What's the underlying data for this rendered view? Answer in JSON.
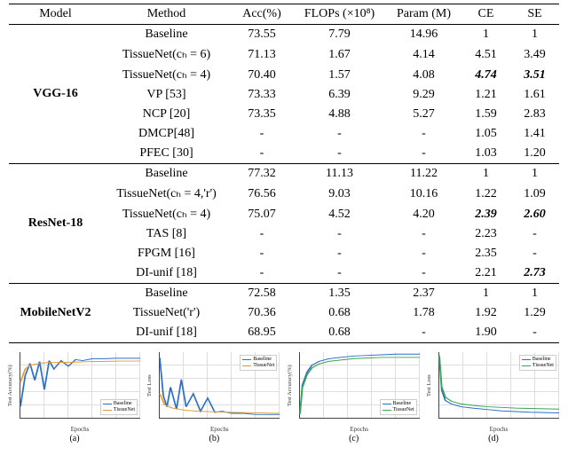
{
  "headers": {
    "model": "Model",
    "method": "Method",
    "acc": "Acc(%)",
    "flops": "FLOPs (×10⁸)",
    "param": "Param (M)",
    "ce": "CE",
    "se": "SE"
  },
  "groups": [
    {
      "model_label": "VGG-16",
      "rows": [
        {
          "method": "Baseline",
          "acc": "73.55",
          "flops": "7.79",
          "param": "14.96",
          "ce": "1",
          "se": "1"
        },
        {
          "method": "TissueNet(cₕ = 6)",
          "acc": "71.13",
          "flops": "1.67",
          "param": "4.14",
          "ce": "4.51",
          "se": "3.49"
        },
        {
          "method": "TissueNet(cₕ = 4)",
          "acc": "70.40",
          "flops": "1.57",
          "param": "4.08",
          "ce": "4.74",
          "se": "3.51",
          "ce_bi": true,
          "se_bi": true
        },
        {
          "method": "VP [53]",
          "acc": "73.33",
          "flops": "6.39",
          "param": "9.29",
          "ce": "1.21",
          "se": "1.61"
        },
        {
          "method": "NCP [20]",
          "acc": "73.35",
          "flops": "4.88",
          "param": "5.27",
          "ce": "1.59",
          "se": "2.83"
        },
        {
          "method": "DMCP[48]",
          "acc": "-",
          "flops": "-",
          "param": "-",
          "ce": "1.05",
          "se": "1.41"
        },
        {
          "method": "PFEC [30]",
          "acc": "-",
          "flops": "-",
          "param": "-",
          "ce": "1.03",
          "se": "1.20"
        }
      ]
    },
    {
      "model_label": "ResNet-18",
      "rows": [
        {
          "method": "Baseline",
          "acc": "77.32",
          "flops": "11.13",
          "param": "11.22",
          "ce": "1",
          "se": "1"
        },
        {
          "method": "TissueNet(cₕ = 4,'r')",
          "acc": "76.56",
          "flops": "9.03",
          "param": "10.16",
          "ce": "1.22",
          "se": "1.09"
        },
        {
          "method": "TissueNet(cₕ = 4)",
          "acc": "75.07",
          "flops": "4.52",
          "param": "4.20",
          "ce": "2.39",
          "se": "2.60",
          "ce_bi": true,
          "se_bi": true
        },
        {
          "method": "TAS [8]",
          "acc": "-",
          "flops": "-",
          "param": "-",
          "ce": "2.23",
          "se": "-"
        },
        {
          "method": "FPGM [16]",
          "acc": "-",
          "flops": "-",
          "param": "-",
          "ce": "2.35",
          "se": "-"
        },
        {
          "method": "DI-unif [18]",
          "acc": "-",
          "flops": "-",
          "param": "-",
          "ce": "2.21",
          "se": "2.73",
          "se_bi": true
        }
      ]
    },
    {
      "model_label": "MobileNetV2",
      "rows": [
        {
          "method": "Baseline",
          "acc": "72.58",
          "flops": "1.35",
          "param": "2.37",
          "ce": "1",
          "se": "1"
        },
        {
          "method": "TissueNet('r')",
          "acc": "70.36",
          "flops": "0.68",
          "param": "1.78",
          "ce": "1.92",
          "se": "1.29"
        },
        {
          "method": "DI-unif [18]",
          "acc": "68.95",
          "flops": "0.68",
          "param": "-",
          "ce": "1.90",
          "se": "-"
        }
      ]
    }
  ],
  "charts": {
    "xlabel": "Epochs",
    "legend": {
      "baseline": "Baseline",
      "tissuenet": "TissueNet"
    },
    "colors": {
      "baseline": "#2b6fca",
      "tissuenet": "#e69a2d",
      "tissuenet_alt": "#3aa553"
    },
    "items": [
      {
        "caption": "(a)",
        "ylabel": "Test Accuracy(%)",
        "ylim": [
          10,
          80
        ],
        "xlim": [
          0,
          500
        ],
        "legend_pos": "br"
      },
      {
        "caption": "(b)",
        "ylabel": "Test Loss",
        "ylim": [
          1,
          7
        ],
        "xlim": [
          0,
          500
        ],
        "legend_pos": "tr"
      },
      {
        "caption": "(c)",
        "ylabel": "Test Accuracy(%)",
        "ylim": [
          45,
          95
        ],
        "xlim": [
          0,
          500
        ],
        "legend_pos": "br",
        "tissuenet_color": "tissuenet_alt"
      },
      {
        "caption": "(d)",
        "ylabel": "Test Loss",
        "ylim": [
          0.1,
          2
        ],
        "xlim": [
          0,
          500
        ],
        "legend_pos": "tr",
        "tissuenet_color": "tissuenet_alt"
      }
    ]
  },
  "chart_data": [
    {
      "type": "line",
      "title": "",
      "xlabel": "Epochs",
      "ylabel": "Test Accuracy(%)",
      "xlim": [
        0,
        500
      ],
      "ylim": [
        10,
        80
      ],
      "series": [
        {
          "name": "Baseline",
          "x": [
            0,
            20,
            40,
            60,
            80,
            100,
            120,
            140,
            170,
            200,
            230,
            260,
            300,
            350,
            400,
            450,
            500
          ],
          "y": [
            22,
            55,
            68,
            50,
            70,
            40,
            71,
            62,
            71,
            65,
            72,
            71,
            73,
            73,
            73.5,
            73.5,
            73.5
          ]
        },
        {
          "name": "TissueNet",
          "x": [
            0,
            20,
            40,
            80,
            120,
            180,
            240,
            300,
            360,
            420,
            500
          ],
          "y": [
            48,
            62,
            66,
            68,
            69,
            69,
            69.5,
            70,
            70.2,
            70.5,
            70.5
          ]
        }
      ]
    },
    {
      "type": "line",
      "title": "",
      "xlabel": "Epochs",
      "ylabel": "Test Loss",
      "xlim": [
        0,
        500
      ],
      "ylim": [
        1,
        7
      ],
      "series": [
        {
          "name": "Baseline",
          "x": [
            0,
            15,
            30,
            45,
            70,
            90,
            110,
            140,
            170,
            200,
            230,
            260,
            300,
            350,
            400,
            450,
            500
          ],
          "y": [
            6.5,
            3.0,
            2.0,
            3.8,
            1.8,
            4.5,
            2.0,
            3.2,
            1.6,
            2.8,
            1.5,
            1.6,
            1.4,
            1.4,
            1.3,
            1.3,
            1.3
          ]
        },
        {
          "name": "TissueNet",
          "x": [
            0,
            20,
            50,
            100,
            160,
            220,
            300,
            400,
            500
          ],
          "y": [
            3.2,
            2.2,
            1.9,
            1.7,
            1.6,
            1.55,
            1.5,
            1.45,
            1.4
          ]
        }
      ]
    },
    {
      "type": "line",
      "title": "",
      "xlabel": "Epochs",
      "ylabel": "Test Accuracy(%)",
      "xlim": [
        0,
        500
      ],
      "ylim": [
        45,
        95
      ],
      "series": [
        {
          "name": "Baseline",
          "x": [
            0,
            10,
            30,
            50,
            80,
            120,
            170,
            220,
            280,
            340,
            400,
            460,
            500
          ],
          "y": [
            48,
            70,
            80,
            85,
            88,
            90,
            91,
            92,
            92.5,
            93,
            93.5,
            93.5,
            93.5
          ]
        },
        {
          "name": "TissueNet",
          "x": [
            0,
            10,
            30,
            50,
            80,
            120,
            170,
            220,
            280,
            340,
            400,
            460,
            500
          ],
          "y": [
            48,
            68,
            78,
            83,
            86,
            88,
            89,
            90,
            90.5,
            91,
            91,
            91,
            91
          ]
        }
      ]
    },
    {
      "type": "line",
      "title": "",
      "xlabel": "Epochs",
      "ylabel": "Test Loss",
      "xlim": [
        0,
        500
      ],
      "ylim": [
        0.1,
        2.0
      ],
      "series": [
        {
          "name": "Baseline",
          "x": [
            0,
            10,
            25,
            50,
            90,
            140,
            200,
            260,
            320,
            380,
            440,
            500
          ],
          "y": [
            1.9,
            0.9,
            0.6,
            0.5,
            0.42,
            0.38,
            0.34,
            0.3,
            0.28,
            0.26,
            0.25,
            0.24
          ]
        },
        {
          "name": "TissueNet",
          "x": [
            0,
            10,
            25,
            50,
            90,
            140,
            200,
            260,
            320,
            380,
            440,
            500
          ],
          "y": [
            1.9,
            1.0,
            0.7,
            0.58,
            0.5,
            0.46,
            0.42,
            0.4,
            0.38,
            0.37,
            0.36,
            0.35
          ]
        }
      ]
    }
  ]
}
